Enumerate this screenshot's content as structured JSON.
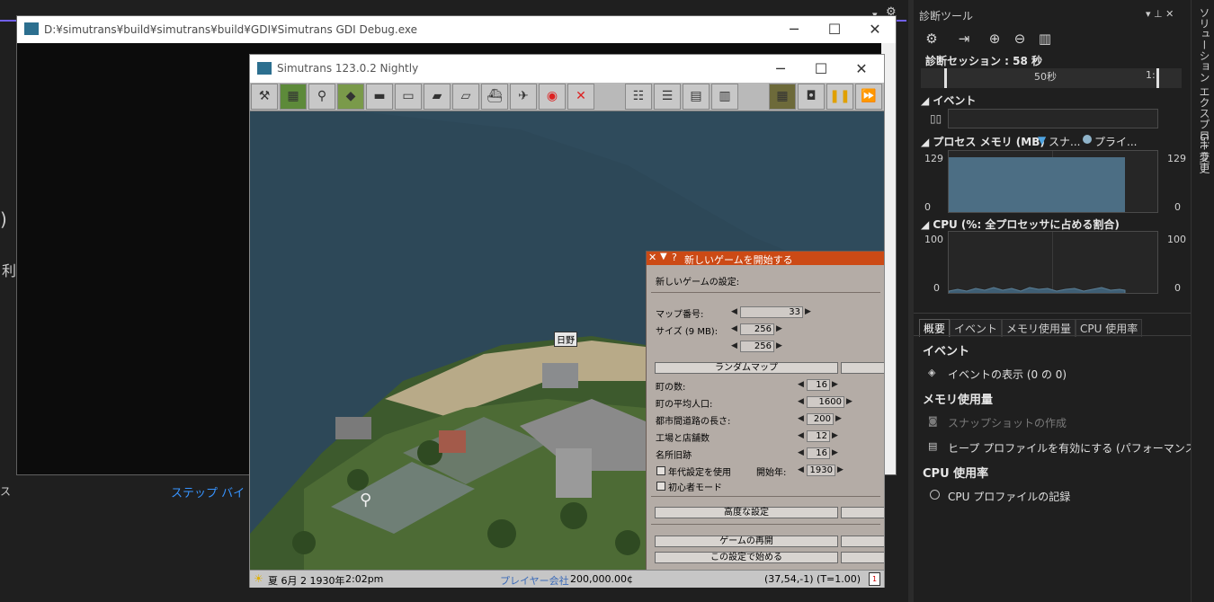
{
  "vs": {
    "frag_paren": ")",
    "frag_kanji": "利",
    "frag_small": "ス",
    "step_by_step": "ステップ バイ ステ"
  },
  "diag": {
    "title": "診断ツール",
    "pin": "▾ ⊥ ✕",
    "session": "診断セッション : 58 秒",
    "ruler_50": "50秒",
    "ruler_1": "1:",
    "events_head": "イベント",
    "process_memory_head": "プロセス メモリ (MB)",
    "legend_snapshot": "スナ...",
    "legend_private": "プライ...",
    "mem_max_left": "129",
    "mem_max_right": "129",
    "mem_min_left": "0",
    "mem_min_right": "0",
    "cpu_head": "CPU (%: 全プロセッサに占める割合)",
    "cpu_max_left": "100",
    "cpu_max_right": "100",
    "cpu_min_left": "0",
    "cpu_min_right": "0",
    "tabs": [
      "概要",
      "イベント",
      "メモリ使用量",
      "CPU 使用率"
    ],
    "summary_events_head": "イベント",
    "show_events": "イベントの表示 (0 の 0)",
    "memory_usage_head": "メモリ使用量",
    "take_snapshot": "スナップショットの作成",
    "enable_heap": "ヒープ プロファイルを有効にする (パフォーマンスに影響します",
    "cpu_usage_head": "CPU 使用率",
    "record_cpu": "CPU プロファイルの記録",
    "colors": {
      "memory_fill": "#4c6e84",
      "cpu_line": "#5b7f96"
    }
  },
  "side_strip": {
    "solution_explorer": "ソリューション エクスプローラー",
    "git_changes": "Git 変更"
  },
  "console": {
    "title": "D:¥simutrans¥build¥simutrans¥build¥GDI¥Simutrans GDI Debug.exe"
  },
  "sim": {
    "title": "Simutrans 123.0.2 Nightly",
    "town_label": "日野",
    "status": {
      "season_date": "夏 6月 2 1930年",
      "time": "2:02pm",
      "player": "プレイヤー会社",
      "money": "200,000.00¢",
      "coords": "(37,54,-1) (T=1.00)"
    },
    "dialog": {
      "title": "新しいゲームを開始する",
      "settings_label": "新しいゲームの設定:",
      "map_no_label": "マップ番号:",
      "map_no": "33",
      "size_label": "サイズ (9 MB):",
      "size_x": "256",
      "size_y": "256",
      "random_map": "ランダムマップ",
      "towns_label": "町の数:",
      "towns": "16",
      "avg_pop_label": "町の平均人口:",
      "avg_pop": "1600",
      "intercity_label": "都市間道路の長さ:",
      "intercity": "200",
      "factories_label": "工場と店舗数",
      "factories": "12",
      "attractions_label": "名所旧跡",
      "attractions": "16",
      "use_timeline_label": "年代設定を使用",
      "start_year_label": "開始年:",
      "start_year": "1930",
      "beginner_label": "初心者モード",
      "advanced": "高度な設定",
      "resume": "ゲームの再開",
      "start_with": "この設定で始める"
    }
  }
}
